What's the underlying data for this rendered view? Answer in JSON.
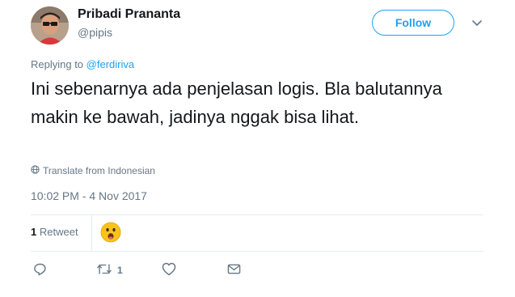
{
  "author": {
    "display_name": "Pribadi Prananta",
    "handle": "@pipis"
  },
  "follow_button": {
    "label": "Follow"
  },
  "replying": {
    "prefix": "Replying to",
    "mention": "@ferdiriva"
  },
  "tweet": {
    "text": "Ini sebenarnya ada penjelasan logis. Bla balutannya makin ke bawah, jadinya nggak bisa lihat."
  },
  "translate": {
    "label": "Translate from Indonesian",
    "icon": "globe-icon"
  },
  "timestamp": "10:02 PM - 4 Nov 2017",
  "stats": {
    "retweet_count": "1",
    "retweet_label": "Retweet"
  },
  "actions": {
    "reply_icon": "reply-icon",
    "retweet_icon": "retweet-icon",
    "retweet_count": "1",
    "like_icon": "heart-icon",
    "dm_icon": "envelope-icon"
  },
  "colors": {
    "accent": "#1da1f2",
    "text": "#14171a",
    "muted": "#657786",
    "divider": "#e6ecf0"
  }
}
